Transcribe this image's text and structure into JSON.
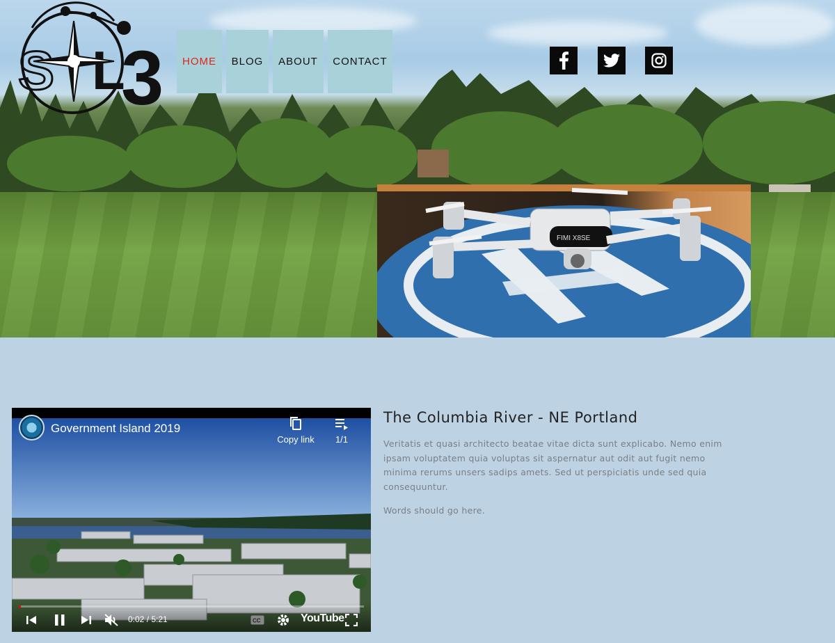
{
  "logo": {
    "text": "SOL3",
    "alt": "SOL3 compass logo"
  },
  "nav": {
    "items": [
      {
        "label": "HOME",
        "active": true
      },
      {
        "label": "BLOG",
        "active": false
      },
      {
        "label": "ABOUT",
        "active": false
      },
      {
        "label": "CONTACT",
        "active": false
      }
    ],
    "active_color": "#e2231a",
    "tile_color": "#a9d1da"
  },
  "social": [
    {
      "name": "facebook-icon"
    },
    {
      "name": "twitter-icon"
    },
    {
      "name": "instagram-icon"
    }
  ],
  "drone": {
    "brand": "FIMI X8SE"
  },
  "video": {
    "title": "Government Island 2019",
    "copy_link": "Copy link",
    "playlist_count": "1/1",
    "time": "0:02 / 5:21",
    "progress": 0.006,
    "brand": "YouTube"
  },
  "article": {
    "title": "The Columbia River - NE Portland",
    "body": "Veritatis et quasi architecto beatae vitae dicta sunt explicabo. Nemo enim ipsam voluptatem quia voluptas sit aspernatur aut odit aut fugit nemo minima rerums unsers sadips amets. Sed ut perspiciatis unde sed quia consequuntur.",
    "footer": "Words should go here."
  },
  "colors": {
    "page_bg": "#bdd3e3",
    "nav_active": "#e2231a",
    "text_muted": "#7a7f86"
  }
}
